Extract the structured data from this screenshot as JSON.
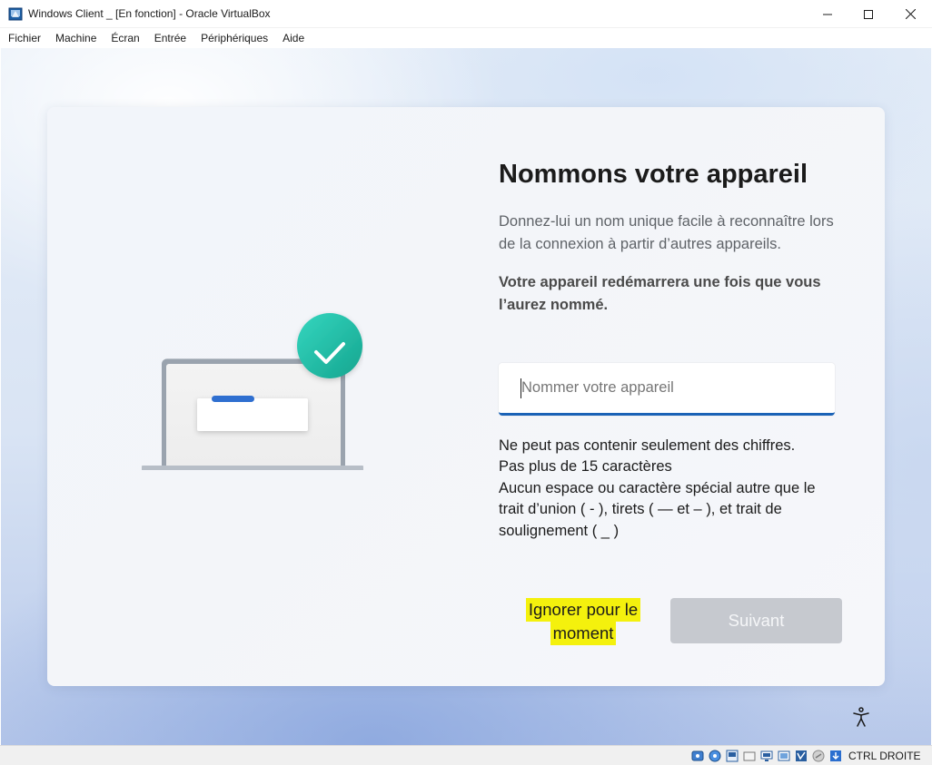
{
  "window": {
    "title": "Windows Client _ [En fonction] - Oracle VirtualBox",
    "minimize_icon": "minimize-icon",
    "maximize_icon": "maximize-icon",
    "close_icon": "close-icon"
  },
  "menubar": {
    "items": [
      "Fichier",
      "Machine",
      "Écran",
      "Entrée",
      "Périphériques",
      "Aide"
    ]
  },
  "oobe": {
    "heading": "Nommons votre appareil",
    "subtitle": "Donnez-lui un nom unique facile à reconnaître lors de la connexion à partir d’autres appareils.",
    "warning": "Votre appareil redémarrera une fois que vous l’aurez nommé.",
    "input": {
      "placeholder": "Nommer votre appareil",
      "value": ""
    },
    "rules": [
      "Ne peut pas contenir seulement des chiffres.",
      "Pas plus de 15 caractères",
      "Aucun espace ou caractère spécial autre que le",
      "trait d’union ( - ), tirets ( — et – ), et trait de",
      "soulignement ( _ )"
    ],
    "skip_button": [
      "Ignorer pour le",
      "moment"
    ],
    "next_button": "Suivant",
    "accent_color": "#1a62b6",
    "highlight_color": "#f4f10d",
    "check_color": "#1fbfa6"
  },
  "statusbar": {
    "icons": [
      "hard-disk-icon",
      "optical-drive-icon",
      "audio-icon",
      "network-icon",
      "usb-icon",
      "shared-folders-icon",
      "display-icon",
      "recording-icon",
      "cpu-icon",
      "mouse-integration-icon",
      "host-key-icon"
    ],
    "host_key": "CTRL DROITE"
  }
}
